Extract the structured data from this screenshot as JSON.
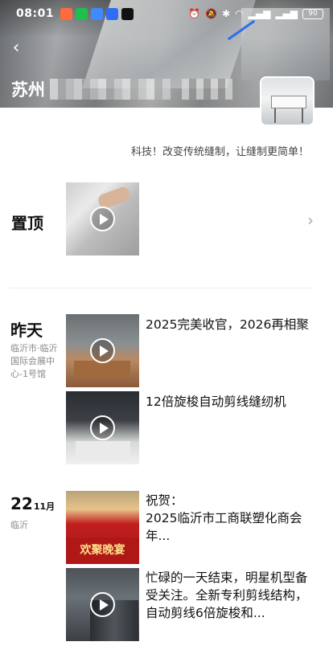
{
  "status_bar": {
    "time": "08:01",
    "battery": "90"
  },
  "header": {
    "company_visible_prefix": "苏州",
    "slogan": "科技！改变传统缝制，让缝制更简单！"
  },
  "pinned": {
    "label": "置顶"
  },
  "groups": [
    {
      "day": "昨天",
      "location": "临沂市·临沂国际会展中心-1号馆",
      "items": [
        {
          "title": "2025完美收官，2026再相聚"
        },
        {
          "title": "12倍旋梭自动剪线缝纫机"
        }
      ]
    },
    {
      "day": "22",
      "month": "11月",
      "location": "临沂",
      "items": [
        {
          "title": "祝贺：\n2025临沂市工商联塑化商会年..."
        },
        {
          "title": "忙碌的一天结束，明星机型备受关注。全新专利剪线结构，自动剪线6倍旋梭和..."
        }
      ]
    }
  ],
  "thumb_text": {
    "stage_banner": "欢聚晚宴"
  },
  "icons": {
    "back": "back-arrow-icon",
    "play": "play-icon",
    "more": "chevron-right-icon"
  },
  "colors": {
    "accent_blue": "#2b6ff0",
    "stage_red": "#b01818"
  }
}
